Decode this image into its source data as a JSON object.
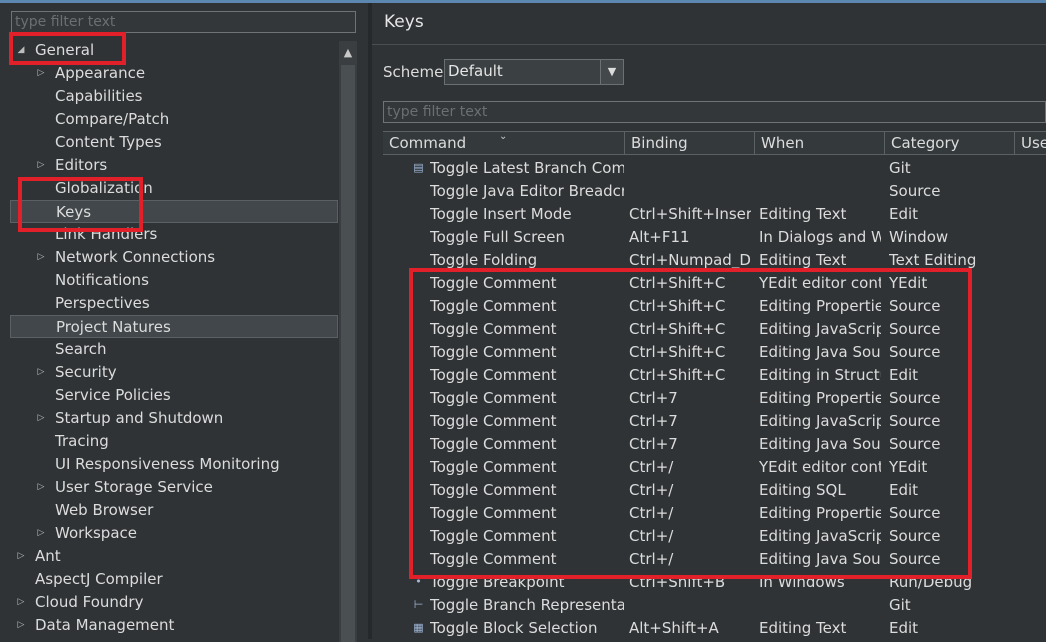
{
  "left": {
    "filter_placeholder": "type filter text",
    "tree": [
      {
        "label": "General",
        "level": 0,
        "twisty": "expanded"
      },
      {
        "label": "Appearance",
        "level": 1,
        "twisty": "collapsed"
      },
      {
        "label": "Capabilities",
        "level": 1,
        "twisty": "none"
      },
      {
        "label": "Compare/Patch",
        "level": 1,
        "twisty": "none"
      },
      {
        "label": "Content Types",
        "level": 1,
        "twisty": "none"
      },
      {
        "label": "Editors",
        "level": 1,
        "twisty": "collapsed"
      },
      {
        "label": "Globalization",
        "level": 1,
        "twisty": "none"
      },
      {
        "label": "Keys",
        "level": 1,
        "twisty": "none",
        "selected": true
      },
      {
        "label": "Link Handlers",
        "level": 1,
        "twisty": "none"
      },
      {
        "label": "Network Connections",
        "level": 1,
        "twisty": "collapsed"
      },
      {
        "label": "Notifications",
        "level": 1,
        "twisty": "none"
      },
      {
        "label": "Perspectives",
        "level": 1,
        "twisty": "none"
      },
      {
        "label": "Project Natures",
        "level": 1,
        "twisty": "none",
        "hover": true
      },
      {
        "label": "Search",
        "level": 1,
        "twisty": "none"
      },
      {
        "label": "Security",
        "level": 1,
        "twisty": "collapsed"
      },
      {
        "label": "Service Policies",
        "level": 1,
        "twisty": "none"
      },
      {
        "label": "Startup and Shutdown",
        "level": 1,
        "twisty": "collapsed"
      },
      {
        "label": "Tracing",
        "level": 1,
        "twisty": "none"
      },
      {
        "label": "UI Responsiveness Monitoring",
        "level": 1,
        "twisty": "none"
      },
      {
        "label": "User Storage Service",
        "level": 1,
        "twisty": "collapsed"
      },
      {
        "label": "Web Browser",
        "level": 1,
        "twisty": "none"
      },
      {
        "label": "Workspace",
        "level": 1,
        "twisty": "collapsed"
      },
      {
        "label": "Ant",
        "level": 0,
        "twisty": "collapsed"
      },
      {
        "label": "AspectJ Compiler",
        "level": 0,
        "twisty": "none"
      },
      {
        "label": "Cloud Foundry",
        "level": 0,
        "twisty": "collapsed"
      },
      {
        "label": "Data Management",
        "level": 0,
        "twisty": "collapsed"
      }
    ]
  },
  "right": {
    "title": "Keys",
    "scheme_label": "Scheme:",
    "scheme_value": "Default",
    "filter_placeholder": "type filter text",
    "columns": [
      "Command",
      "Binding",
      "When",
      "Category",
      "User"
    ],
    "rows": [
      {
        "icon": "doc-icon",
        "command": "Toggle Latest Branch Commit",
        "binding": "",
        "when": "",
        "category": "Git"
      },
      {
        "icon": "",
        "command": "Toggle Java Editor Breadcrumb",
        "binding": "",
        "when": "",
        "category": "Source"
      },
      {
        "icon": "",
        "command": "Toggle Insert Mode",
        "binding": "Ctrl+Shift+Insert",
        "when": "Editing Text",
        "category": "Edit"
      },
      {
        "icon": "",
        "command": "Toggle Full Screen",
        "binding": "Alt+F11",
        "when": "In Dialogs and Windows",
        "category": "Window"
      },
      {
        "icon": "",
        "command": "Toggle Folding",
        "binding": "Ctrl+Numpad_Divide",
        "when": "Editing Text",
        "category": "Text Editing"
      },
      {
        "icon": "",
        "command": "Toggle Comment",
        "binding": "Ctrl+Shift+C",
        "when": "YEdit editor context",
        "category": "YEdit"
      },
      {
        "icon": "",
        "command": "Toggle Comment",
        "binding": "Ctrl+Shift+C",
        "when": "Editing Properties Files",
        "category": "Source"
      },
      {
        "icon": "",
        "command": "Toggle Comment",
        "binding": "Ctrl+Shift+C",
        "when": "Editing JavaScript Source",
        "category": "Source"
      },
      {
        "icon": "",
        "command": "Toggle Comment",
        "binding": "Ctrl+Shift+C",
        "when": "Editing Java Source",
        "category": "Source"
      },
      {
        "icon": "",
        "command": "Toggle Comment",
        "binding": "Ctrl+Shift+C",
        "when": "Editing in Structured Text Editors",
        "category": "Edit"
      },
      {
        "icon": "",
        "command": "Toggle Comment",
        "binding": "Ctrl+7",
        "when": "Editing Properties Files",
        "category": "Source"
      },
      {
        "icon": "",
        "command": "Toggle Comment",
        "binding": "Ctrl+7",
        "when": "Editing JavaScript Source",
        "category": "Source"
      },
      {
        "icon": "",
        "command": "Toggle Comment",
        "binding": "Ctrl+7",
        "when": "Editing Java Source",
        "category": "Source"
      },
      {
        "icon": "",
        "command": "Toggle Comment",
        "binding": "Ctrl+/",
        "when": "YEdit editor context",
        "category": "YEdit"
      },
      {
        "icon": "",
        "command": "Toggle Comment",
        "binding": "Ctrl+/",
        "when": "Editing SQL",
        "category": "Edit"
      },
      {
        "icon": "",
        "command": "Toggle Comment",
        "binding": "Ctrl+/",
        "when": "Editing Properties Files",
        "category": "Source"
      },
      {
        "icon": "",
        "command": "Toggle Comment",
        "binding": "Ctrl+/",
        "when": "Editing JavaScript Source",
        "category": "Source"
      },
      {
        "icon": "",
        "command": "Toggle Comment",
        "binding": "Ctrl+/",
        "when": "Editing Java Source",
        "category": "Source"
      },
      {
        "icon": "dot-icon",
        "command": "Toggle Breakpoint",
        "binding": "Ctrl+Shift+B",
        "when": "In Windows",
        "category": "Run/Debug"
      },
      {
        "icon": "tree-icon",
        "command": "Toggle Branch Representation",
        "binding": "",
        "when": "",
        "category": "Git"
      },
      {
        "icon": "block-icon",
        "command": "Toggle Block Selection",
        "binding": "Alt+Shift+A",
        "when": "Editing Text",
        "category": "Edit"
      }
    ]
  },
  "colors": {
    "highlight": "#e2202a",
    "background": "#2f3335",
    "text": "#dcdcdc"
  }
}
